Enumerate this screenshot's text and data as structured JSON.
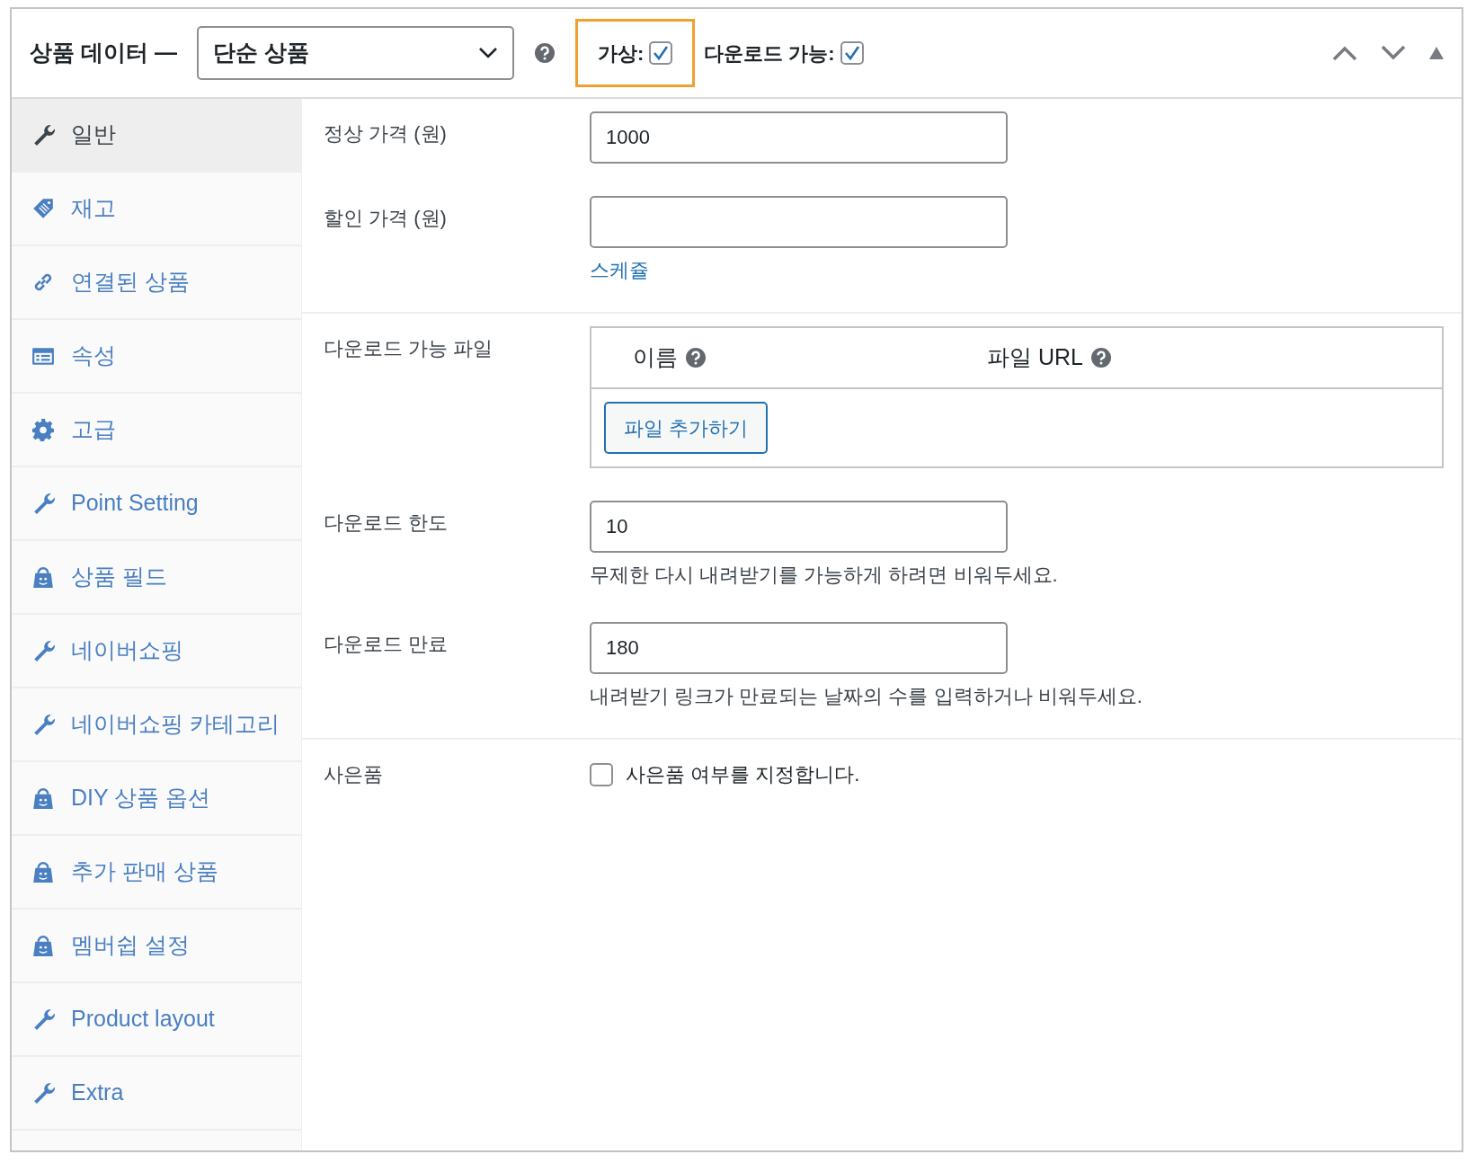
{
  "header": {
    "title": "상품 데이터 —",
    "product_type": "단순 상품",
    "options": [
      {
        "label": "가상:",
        "checked": true,
        "highlighted": true
      },
      {
        "label": "다운로드 가능:",
        "checked": true,
        "highlighted": false
      }
    ]
  },
  "tabs": [
    {
      "label": "일반",
      "kind": "wrench",
      "selected": true
    },
    {
      "label": "재고",
      "kind": "tag",
      "selected": false
    },
    {
      "label": "연결된 상품",
      "kind": "link",
      "selected": false
    },
    {
      "label": "속성",
      "kind": "table",
      "selected": false
    },
    {
      "label": "고급",
      "kind": "gear",
      "selected": false
    },
    {
      "label": "Point Setting",
      "kind": "wrench",
      "selected": false
    },
    {
      "label": "상품 필드",
      "kind": "bag",
      "selected": false
    },
    {
      "label": "네이버쇼핑",
      "kind": "wrench",
      "selected": false
    },
    {
      "label": "네이버쇼핑 카테고리",
      "kind": "wrench",
      "selected": false
    },
    {
      "label": "DIY 상품 옵션",
      "kind": "bag",
      "selected": false
    },
    {
      "label": "추가 판매 상품",
      "kind": "bag",
      "selected": false
    },
    {
      "label": "멤버쉽 설정",
      "kind": "bag",
      "selected": false
    },
    {
      "label": "Product layout",
      "kind": "wrench",
      "selected": false
    },
    {
      "label": "Extra",
      "kind": "wrench",
      "selected": false
    }
  ],
  "sections": [
    [
      {
        "kind": "input",
        "label": "정상 가격 (원)",
        "value": "1000"
      },
      {
        "kind": "input",
        "label": "할인 가격 (원)",
        "link": "스케쥴"
      }
    ],
    [
      {
        "kind": "files",
        "label": "다운로드 가능 파일",
        "columns": [
          "이름",
          "파일 URL"
        ],
        "button": "파일 추가하기"
      },
      {
        "kind": "input",
        "label": "다운로드 한도",
        "value": "10",
        "hint": "무제한 다시 내려받기를 가능하게 하려면 비워두세요."
      },
      {
        "kind": "input",
        "label": "다운로드 만료",
        "value": "180",
        "hint": "내려받기 링크가 만료되는 날짜의 수를 입력하거나 비워두세요."
      }
    ],
    [
      {
        "kind": "checkbox",
        "label": "사은품",
        "text": "사은품 여부를 지정합니다.",
        "checked": false
      }
    ]
  ]
}
